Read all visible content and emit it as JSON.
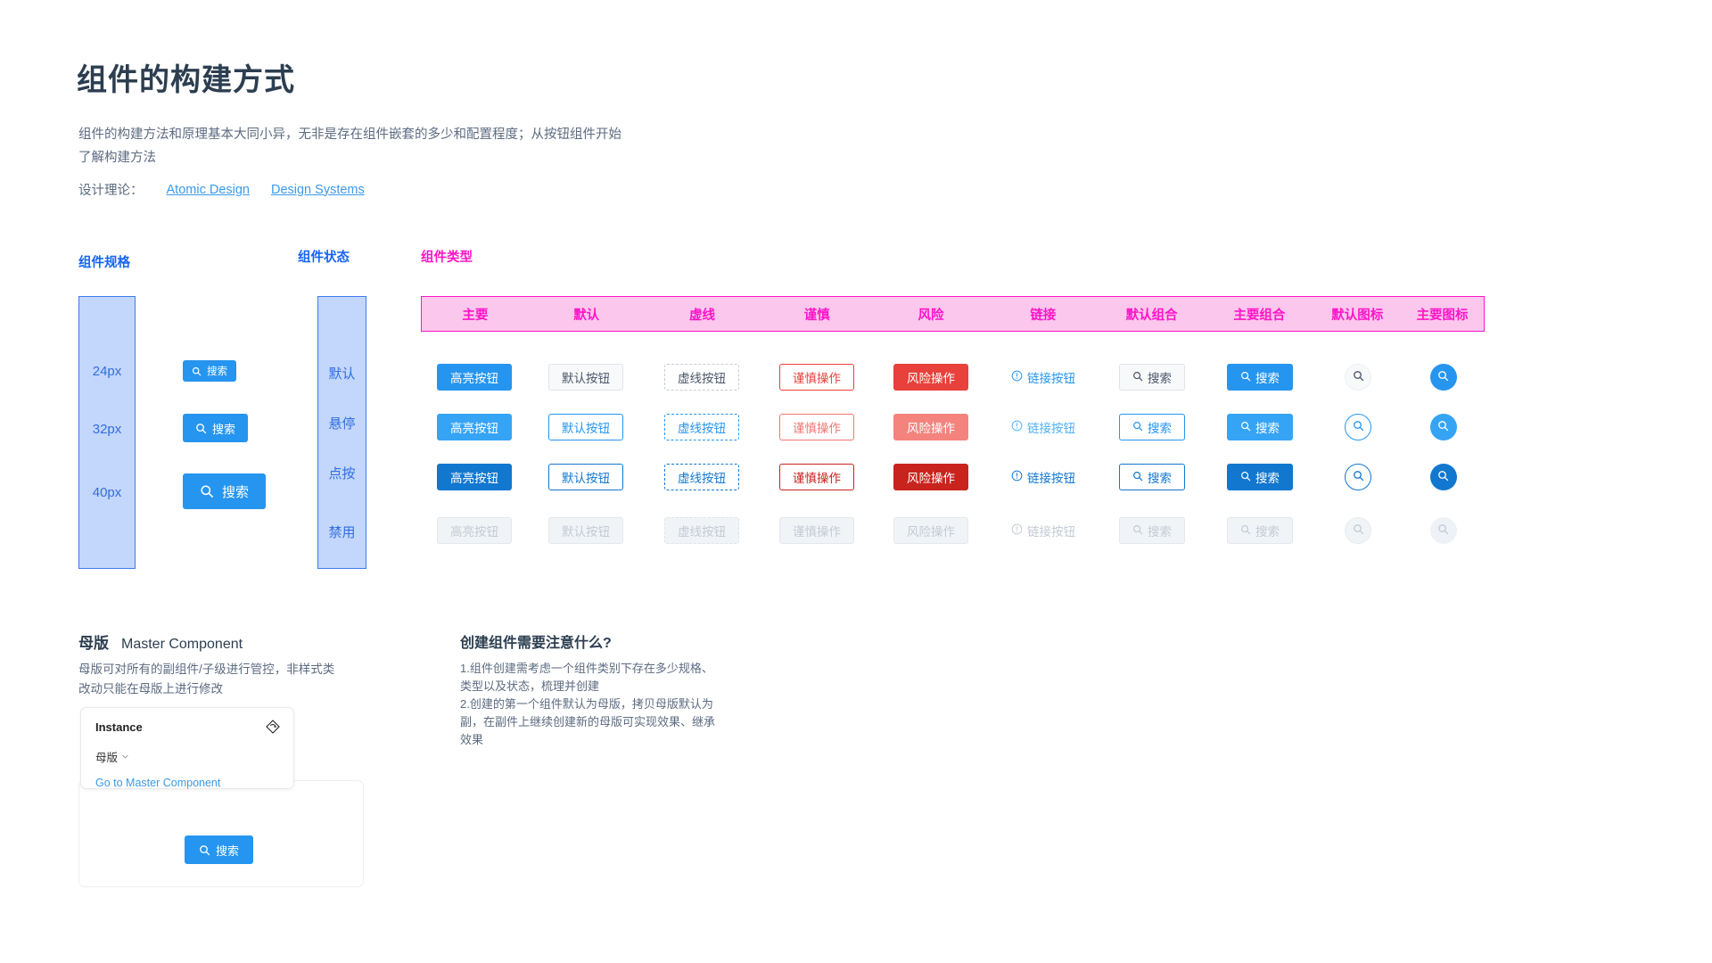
{
  "header": {
    "title": "组件的构建方式",
    "description": "组件的构建方法和原理基本大同小异，无非是存在组件嵌套的多少和配置程度；从按钮组件开始了解构建方法",
    "theory_label": "设计理论：",
    "links": [
      {
        "label": "Atomic Design"
      },
      {
        "label": "Design Systems"
      }
    ]
  },
  "specs": {
    "caption": "组件规格",
    "sizes": [
      {
        "label": "24px",
        "button_text": "搜索",
        "icon": "search-icon"
      },
      {
        "label": "32px",
        "button_text": "搜索",
        "icon": "search-icon"
      },
      {
        "label": "40px",
        "button_text": "搜索",
        "icon": "search-icon"
      }
    ]
  },
  "states": {
    "caption": "组件状态",
    "items": [
      {
        "label": "默认"
      },
      {
        "label": "悬停"
      },
      {
        "label": "点按"
      },
      {
        "label": "禁用"
      }
    ]
  },
  "types": {
    "caption": "组件类型",
    "columns": [
      "主要",
      "默认",
      "虚线",
      "谨慎",
      "风险",
      "链接",
      "默认组合",
      "主要组合",
      "默认图标",
      "主要图标"
    ],
    "labels": {
      "primary": "高亮按钮",
      "default": "默认按钮",
      "dashed": "虚线按钮",
      "caution": "谨慎操作",
      "risk": "风险操作",
      "link": "链接按钮",
      "combo": "搜索"
    },
    "icons": {
      "search": "search-icon",
      "link_prefix": "exclamation-circle-icon"
    }
  },
  "master": {
    "heading_zh": "母版",
    "heading_en": "Master Component",
    "description": "母版可对所有的副组件/子级进行管控，非样式类改动只能在母版上进行修改",
    "instance": {
      "title": "Instance",
      "selector_value": "母版",
      "selector_icon": "chevron-down-icon",
      "master_icon": "master-component-icon",
      "link": "Go to Master Component"
    },
    "preview_button": {
      "text": "搜索",
      "icon": "search-icon"
    }
  },
  "faq": {
    "title": "创建组件需要注意什么?",
    "lines": [
      "1.组件创建需考虑一个组件类别下存在多少规格、类型以及状态，梳理并创建",
      "2.创建的第一个组件默认为母版，拷贝母版默认为副，在副件上继续创建新的母版可实现效果、继承效果"
    ]
  },
  "colors": {
    "primary": "#2595ef",
    "risk": "#e8403a",
    "caution": "#e8403a",
    "link": "#2595ef",
    "spec_accent": "#1565f5",
    "type_accent": "#ff14c8",
    "panel_fill": "#c3d6fb",
    "band_fill": "#fcc7ec"
  }
}
